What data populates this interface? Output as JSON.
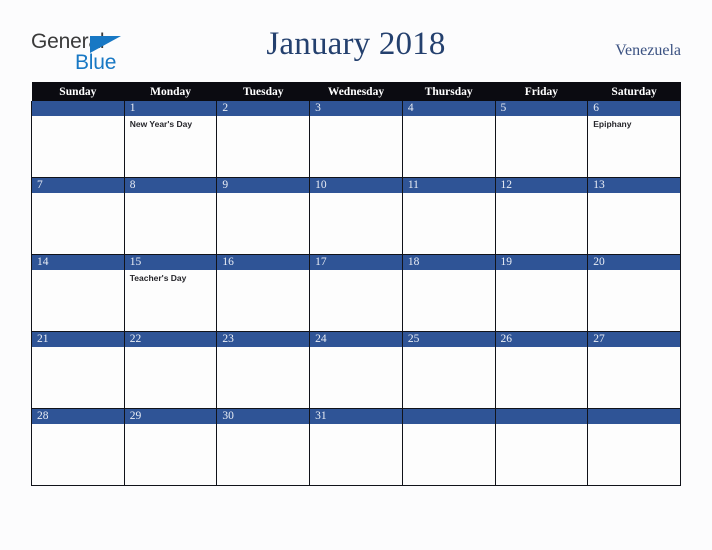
{
  "brand": {
    "name_top": "General",
    "name_bottom": "Blue",
    "triangle_color": "#1878c4",
    "top_color": "#3a3a3a"
  },
  "header": {
    "title": "January 2018",
    "country": "Venezuela",
    "title_color": "#24406e"
  },
  "theme": {
    "day_bar_color": "#2f5496",
    "weekday_header_bg": "#0b0b11",
    "weekday_header_text": "#ffffff",
    "page_background": "#fcfcfd",
    "cell_background": "#fdfdfd",
    "grid_line": "#11131a"
  },
  "calendar": {
    "month": "January",
    "year": "2018",
    "weekday_headers": [
      "Sunday",
      "Monday",
      "Tuesday",
      "Wednesday",
      "Thursday",
      "Friday",
      "Saturday"
    ],
    "weeks": [
      [
        {
          "date": "",
          "event": ""
        },
        {
          "date": "1",
          "event": "New Year's Day"
        },
        {
          "date": "2",
          "event": ""
        },
        {
          "date": "3",
          "event": ""
        },
        {
          "date": "4",
          "event": ""
        },
        {
          "date": "5",
          "event": ""
        },
        {
          "date": "6",
          "event": "Epiphany"
        }
      ],
      [
        {
          "date": "7",
          "event": ""
        },
        {
          "date": "8",
          "event": ""
        },
        {
          "date": "9",
          "event": ""
        },
        {
          "date": "10",
          "event": ""
        },
        {
          "date": "11",
          "event": ""
        },
        {
          "date": "12",
          "event": ""
        },
        {
          "date": "13",
          "event": ""
        }
      ],
      [
        {
          "date": "14",
          "event": ""
        },
        {
          "date": "15",
          "event": "Teacher's Day"
        },
        {
          "date": "16",
          "event": ""
        },
        {
          "date": "17",
          "event": ""
        },
        {
          "date": "18",
          "event": ""
        },
        {
          "date": "19",
          "event": ""
        },
        {
          "date": "20",
          "event": ""
        }
      ],
      [
        {
          "date": "21",
          "event": ""
        },
        {
          "date": "22",
          "event": ""
        },
        {
          "date": "23",
          "event": ""
        },
        {
          "date": "24",
          "event": ""
        },
        {
          "date": "25",
          "event": ""
        },
        {
          "date": "26",
          "event": ""
        },
        {
          "date": "27",
          "event": ""
        }
      ],
      [
        {
          "date": "28",
          "event": ""
        },
        {
          "date": "29",
          "event": ""
        },
        {
          "date": "30",
          "event": ""
        },
        {
          "date": "31",
          "event": ""
        },
        {
          "date": "",
          "event": ""
        },
        {
          "date": "",
          "event": ""
        },
        {
          "date": "",
          "event": ""
        }
      ]
    ]
  }
}
